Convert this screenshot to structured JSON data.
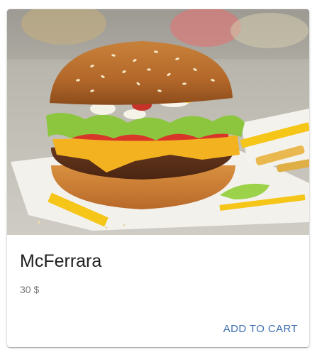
{
  "product": {
    "name": "McFerrara",
    "price": "30 $",
    "image_subject": "burger-photo"
  },
  "actions": {
    "add_to_cart_label": "ADD TO CART"
  },
  "colors": {
    "accent": "#3f6fb0",
    "title_text": "#212121",
    "price_text": "#757575"
  }
}
